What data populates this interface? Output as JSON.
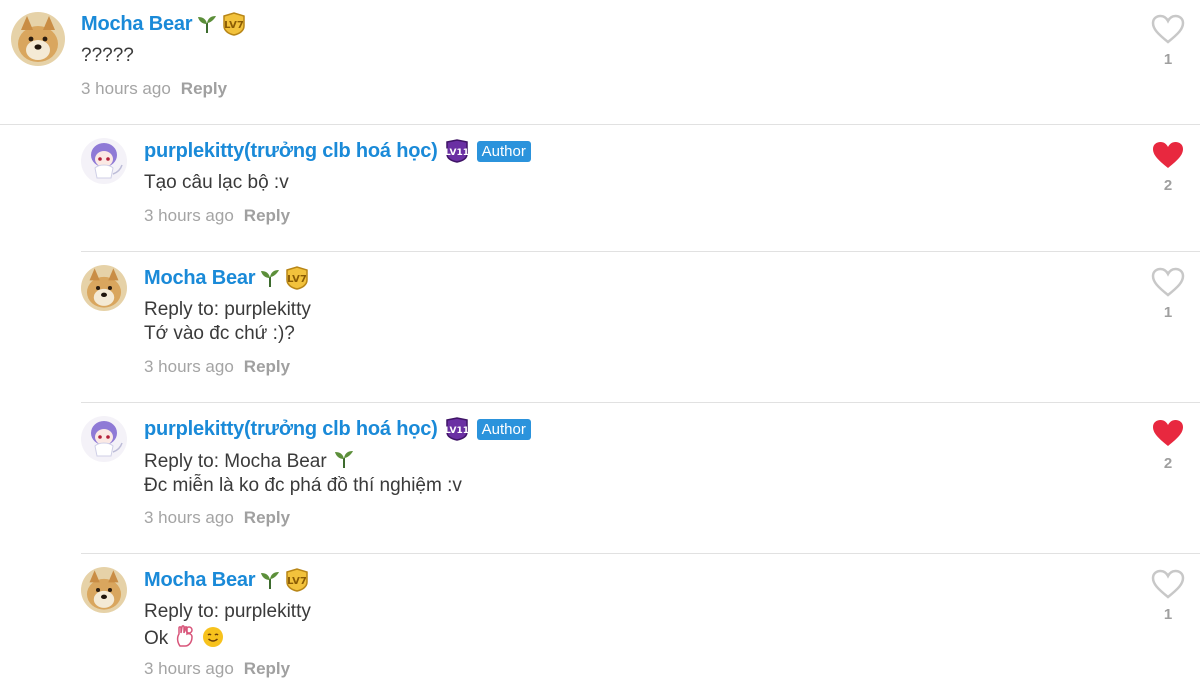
{
  "comments": [
    {
      "username": "Mocha Bear",
      "author_badge": "",
      "level": "LV7",
      "lines": [
        "?????"
      ],
      "time": "3 hours ago",
      "reply_label": "Reply",
      "likes": "1",
      "liked": false,
      "avatar": "doge-avatar"
    },
    {
      "username": "purplekitty(trưởng clb hoá học)",
      "author_badge": "Author",
      "level": "LV11",
      "lines": [
        "Tạo câu lạc bộ :v"
      ],
      "time": "3 hours ago",
      "reply_label": "Reply",
      "likes": "2",
      "liked": true,
      "avatar": "purple-anime-avatar"
    },
    {
      "username": "Mocha Bear",
      "author_badge": "",
      "level": "LV7",
      "lines": [
        "Reply to: purplekitty",
        "Tớ vào đc chứ :)?"
      ],
      "time": "3 hours ago",
      "reply_label": "Reply",
      "likes": "1",
      "liked": false,
      "avatar": "doge-avatar"
    },
    {
      "username": "purplekitty(trưởng clb hoá học)",
      "author_badge": "Author",
      "level": "LV11",
      "lines": [
        "Reply to: Mocha Bear",
        "Đc miễn là ko đc phá đồ thí nghiệm :v"
      ],
      "time": "3 hours ago",
      "reply_label": "Reply",
      "likes": "2",
      "liked": true,
      "avatar": "purple-anime-avatar"
    },
    {
      "username": "Mocha Bear",
      "author_badge": "",
      "level": "LV7",
      "lines": [
        "Reply to: purplekitty",
        "Ok"
      ],
      "time": "3 hours ago",
      "reply_label": "Reply",
      "likes": "1",
      "liked": false,
      "avatar": "doge-avatar"
    }
  ],
  "colors": {
    "username": "#1a8ad8",
    "author_badge_bg": "#2b93dc",
    "heart_liked": "#e8283f",
    "heart_unliked": "#c8c8c8",
    "meta_text": "#a4a4a4"
  },
  "icons": {
    "sprout": "sprout-icon",
    "level_badge": "level-badge-icon",
    "like": "heart-icon",
    "emoji_ok_hand": "ok-hand-emoji",
    "emoji_smile": "smiling-face-emoji"
  }
}
